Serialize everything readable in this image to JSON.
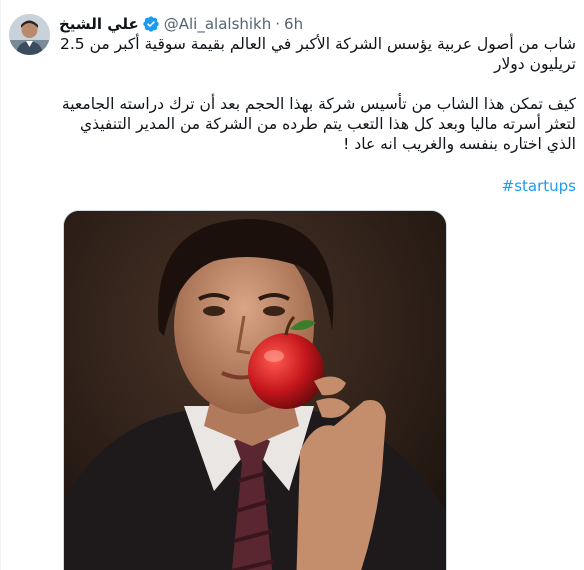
{
  "tweet": {
    "author": {
      "display_name": "علي الشيخ",
      "handle": "@Ali_alalshikh",
      "verified": true,
      "verified_color": "#1d9bf0"
    },
    "separator": "·",
    "timestamp": "6h",
    "text_lines": [
      "شاب من أصول عربية يؤسس الشركة الأكبر في العالم بقيمة سوقية أكبر من 2.5 تريليون دولار",
      "كيف تمكن هذا الشاب من تأسيس شركة بهذا الحجم بعد أن ترك دراسته الجامعية لتعثر أسرته ماليا وبعد كل هذا التعب يتم طرده من الشركة من المدير التنفيذي الذي اختاره بنفسه والغريب انه عاد !"
    ],
    "hashtag": "#startups",
    "link_color": "#1d9bf0"
  }
}
